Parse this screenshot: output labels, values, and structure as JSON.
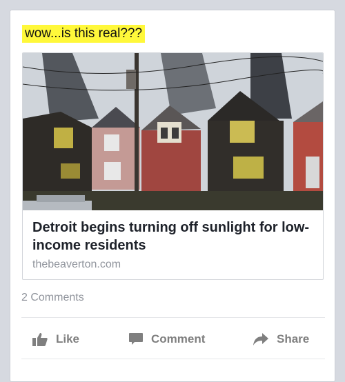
{
  "post": {
    "text": "wow...is this real???"
  },
  "link": {
    "title": "Detroit begins turning off sunlight for low-income residents",
    "domain": "thebeaverton.com"
  },
  "stats": {
    "comments": "2 Comments"
  },
  "actions": {
    "like": "Like",
    "comment": "Comment",
    "share": "Share"
  },
  "icons": {
    "like": "thumbs-up-icon",
    "comment": "speech-bubble-icon",
    "share": "share-arrow-icon"
  },
  "colors": {
    "highlight": "#fff83a",
    "muted": "#90949c",
    "icon": "#7f7f7f"
  }
}
